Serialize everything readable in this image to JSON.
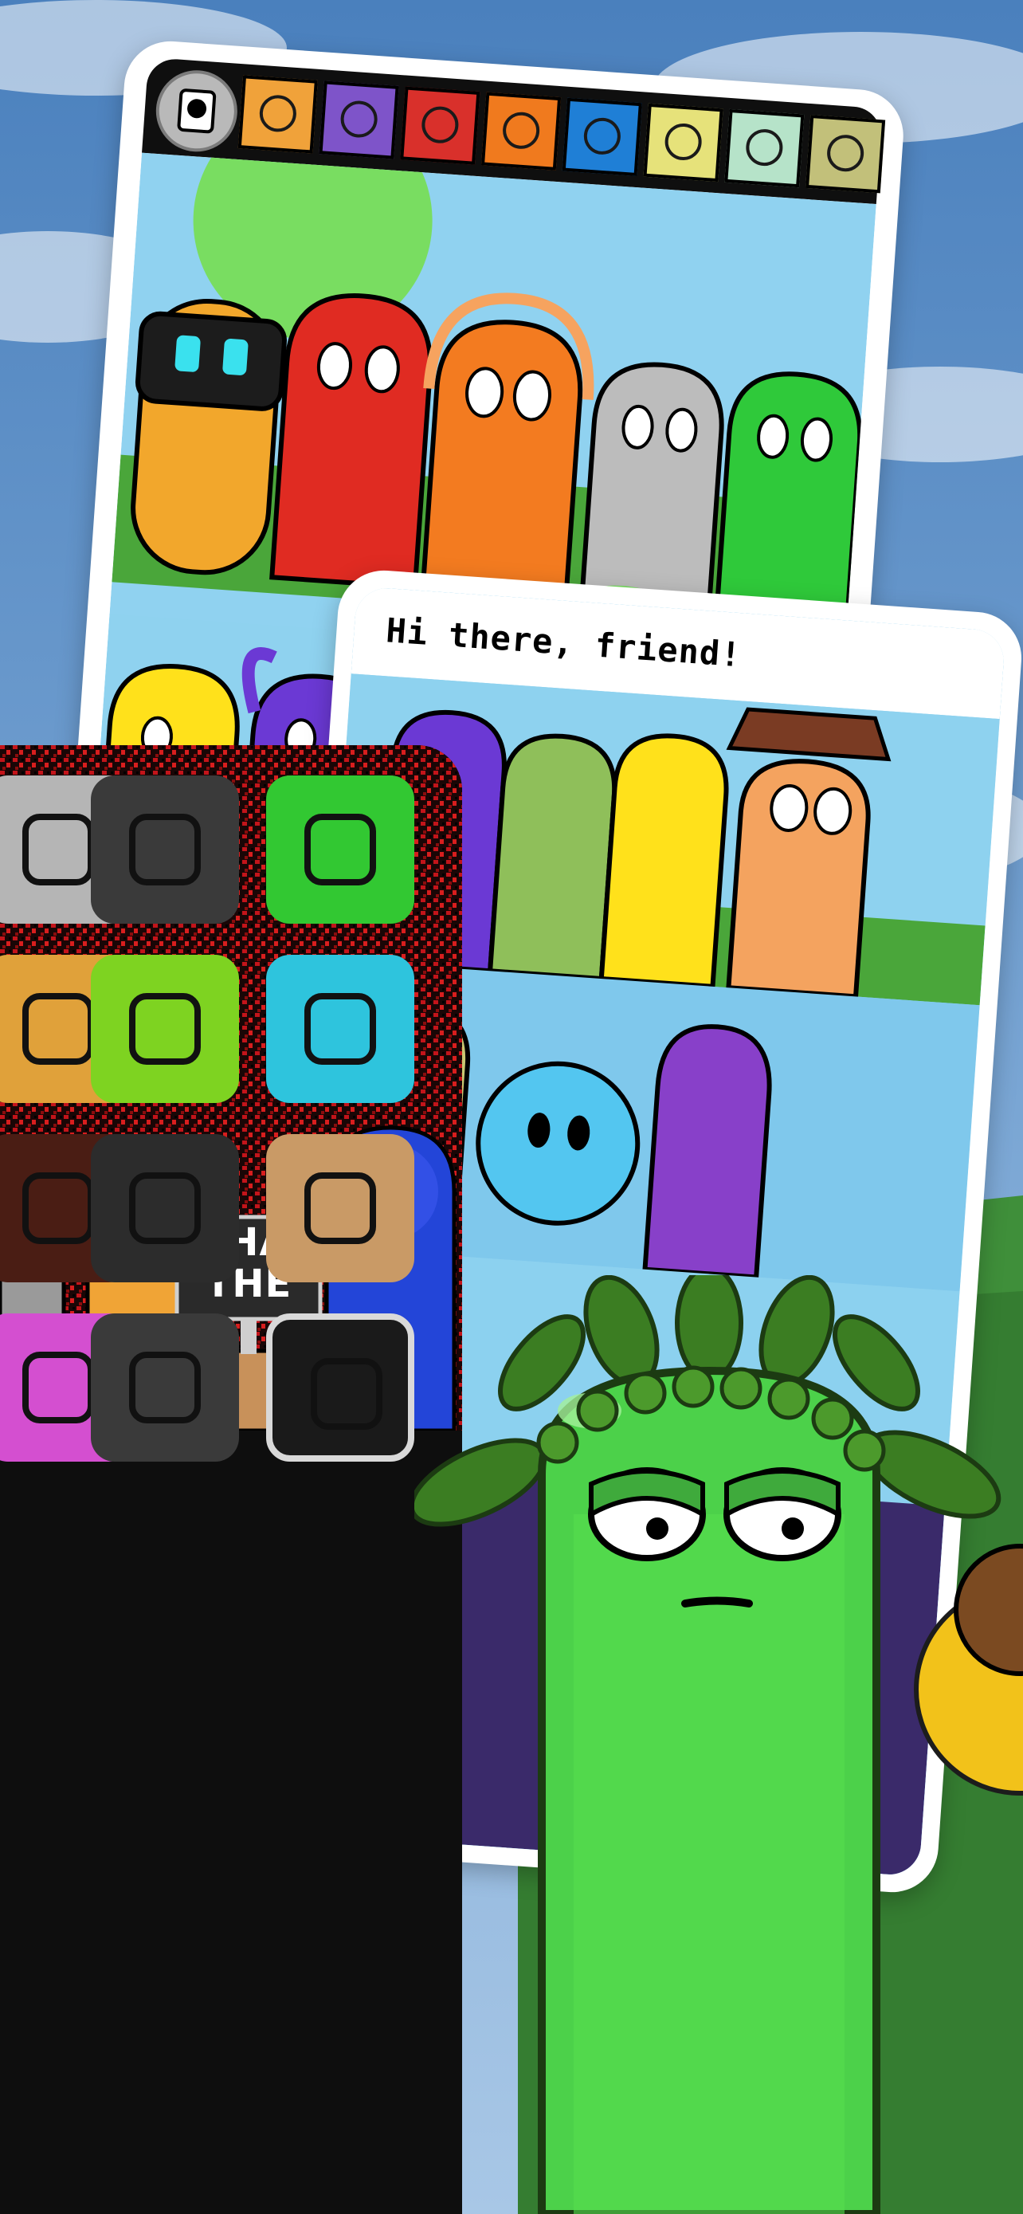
{
  "store_screenshot": {
    "background": {
      "sky_top": "#4f86c0",
      "sky_bottom": "#b9d3ea",
      "hill_color": "#3f8f3a"
    },
    "top_card": {
      "toolbar": {
        "slots": [
          {
            "icon": "headphones-robot-icon",
            "color": "#f0a23a"
          },
          {
            "icon": "shades-icon",
            "color": "#7e54c9"
          },
          {
            "icon": "split-face-icon",
            "color": "#d9302b"
          },
          {
            "icon": "flame-icon",
            "color": "#f07a1e"
          },
          {
            "icon": "blue-mouth-icon",
            "color": "#1f7fd6"
          },
          {
            "icon": "egg-icon",
            "color": "#e6e27a"
          },
          {
            "icon": "mustache-icon",
            "color": "#b6e3c9"
          },
          {
            "icon": "olive-hat-icon",
            "color": "#c2c07a"
          }
        ]
      }
    },
    "middle_card": {
      "speech": "Hi there, friend!"
    },
    "left_card": {
      "sign_line1": "WHAT",
      "sign_line2": "THE",
      "icon_grid": [
        {
          "icon": "leash-icon",
          "color": "#b5b5b5"
        },
        {
          "icon": "headband-icon",
          "color": "#3a3a3a"
        },
        {
          "icon": "flower-leaf-icon",
          "color": "#32c832"
        },
        {
          "icon": "bars-icon",
          "color": "#e0a13a"
        },
        {
          "icon": "fishing-rod-icon",
          "color": "#7ed321"
        },
        {
          "icon": "glasses-round-icon",
          "color": "#2ec4dd"
        },
        {
          "icon": "sprout-icon",
          "color": "#4a1d14"
        },
        {
          "icon": "earbuds-icon",
          "color": "#2c2c2c"
        },
        {
          "icon": "cowboy-hat-icon",
          "color": "#c99a66"
        },
        {
          "icon": "bow-icon",
          "color": "#d44fd0"
        },
        {
          "icon": "skull-icon",
          "color": "#3a3a3a"
        },
        {
          "icon": "top-hat-icon",
          "color": "#1a1a1a"
        }
      ]
    },
    "mascot": {
      "name": "green-leaf-character",
      "body": "#4cd14a",
      "outline": "#1c3b12"
    }
  }
}
